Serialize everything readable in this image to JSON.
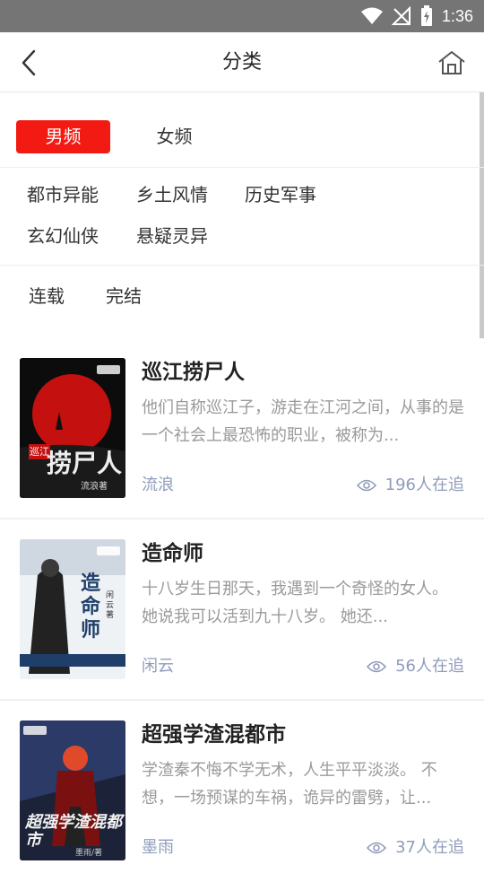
{
  "status_bar": {
    "time": "1:36"
  },
  "header": {
    "title": "分类"
  },
  "gender_tabs": [
    {
      "label": "男频",
      "active": true
    },
    {
      "label": "女频",
      "active": false
    }
  ],
  "categories": [
    "都市异能",
    "乡土风情",
    "历史军事",
    "玄幻仙侠",
    "悬疑灵异"
  ],
  "status_filters": [
    "连载",
    "完结"
  ],
  "colors": {
    "accent": "#f21a12",
    "meta": "#8f9cbb",
    "desc": "#9a9a9a"
  },
  "books": [
    {
      "title": "巡江捞尸人",
      "desc": "他们自称巡江子，游走在江河之间，从事的是一个社会上最恐怖的职业，被称为...",
      "author": "流浪",
      "readers": "196人在追",
      "cover": {
        "title_big": "捞尸人",
        "title_small": "巡江",
        "author": "流浪著"
      }
    },
    {
      "title": "造命师",
      "desc": "十八岁生日那天，我遇到一个奇怪的女人。 她说我可以活到九十八岁。 她还...",
      "author": "闲云",
      "readers": "56人在追",
      "cover": {
        "title_big": "造命师",
        "author": "闲云著"
      }
    },
    {
      "title": "超强学渣混都市",
      "desc": "学渣秦不悔不学无术，人生平平淡淡。 不想，一场预谋的车祸，诡异的雷劈，让...",
      "author": "墨雨",
      "readers": "37人在追",
      "cover": {
        "title_big": "超强学渣混都市",
        "author": "墨雨/著"
      }
    }
  ]
}
